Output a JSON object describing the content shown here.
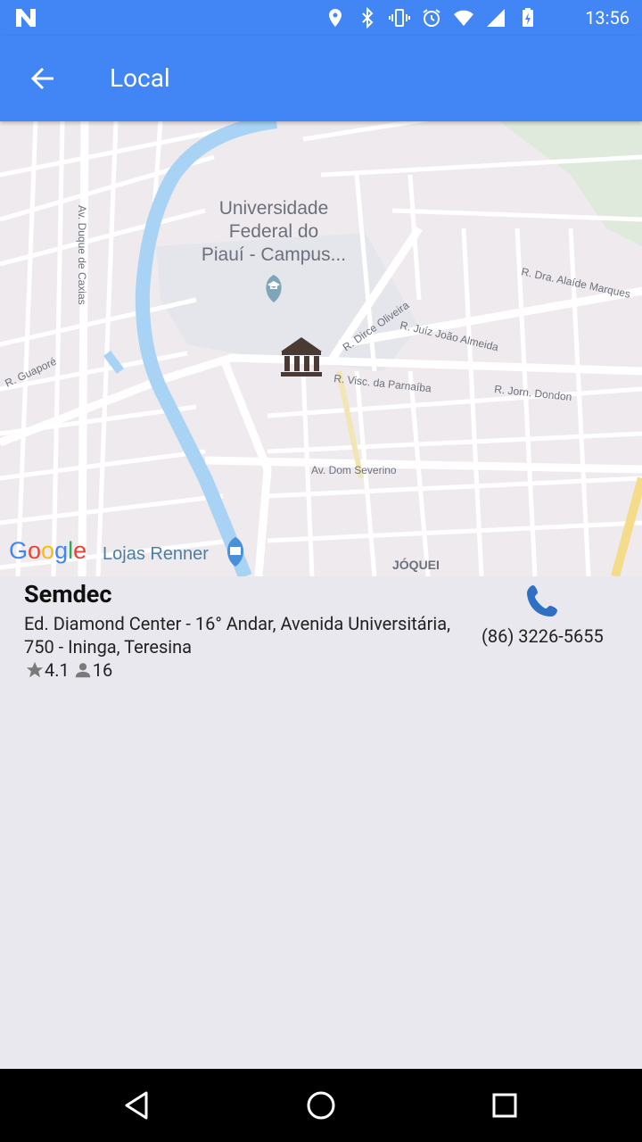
{
  "status_bar": {
    "time": "13:56"
  },
  "app_bar": {
    "title": "Local"
  },
  "map": {
    "labels": {
      "university": [
        "Universidade",
        "Federal do",
        "Piauí - Campus..."
      ],
      "av_duque": "Av. Duque de Caxias",
      "r_guapore": "R. Guaporé",
      "r_alaide": "R. Dra. Alaíde Marques",
      "r_dirce": "R. Dirce Oliveira",
      "r_juiz": "R. Juíz João Almeida",
      "r_visc": "R. Visc. da Parnaíba",
      "r_jorn": "R. Jorn. Dondon",
      "av_dom": "Av. Dom Severino",
      "lojas": "Lojas Renner",
      "joquei": "JÓQUEI",
      "google": "Google"
    }
  },
  "place": {
    "name": "Semdec",
    "address": "Ed. Diamond Center - 16° Andar, Avenida Universitária, 750 - Ininga, Teresina",
    "rating": "4.1",
    "reviews": "16",
    "phone": "(86) 3226-5655"
  }
}
